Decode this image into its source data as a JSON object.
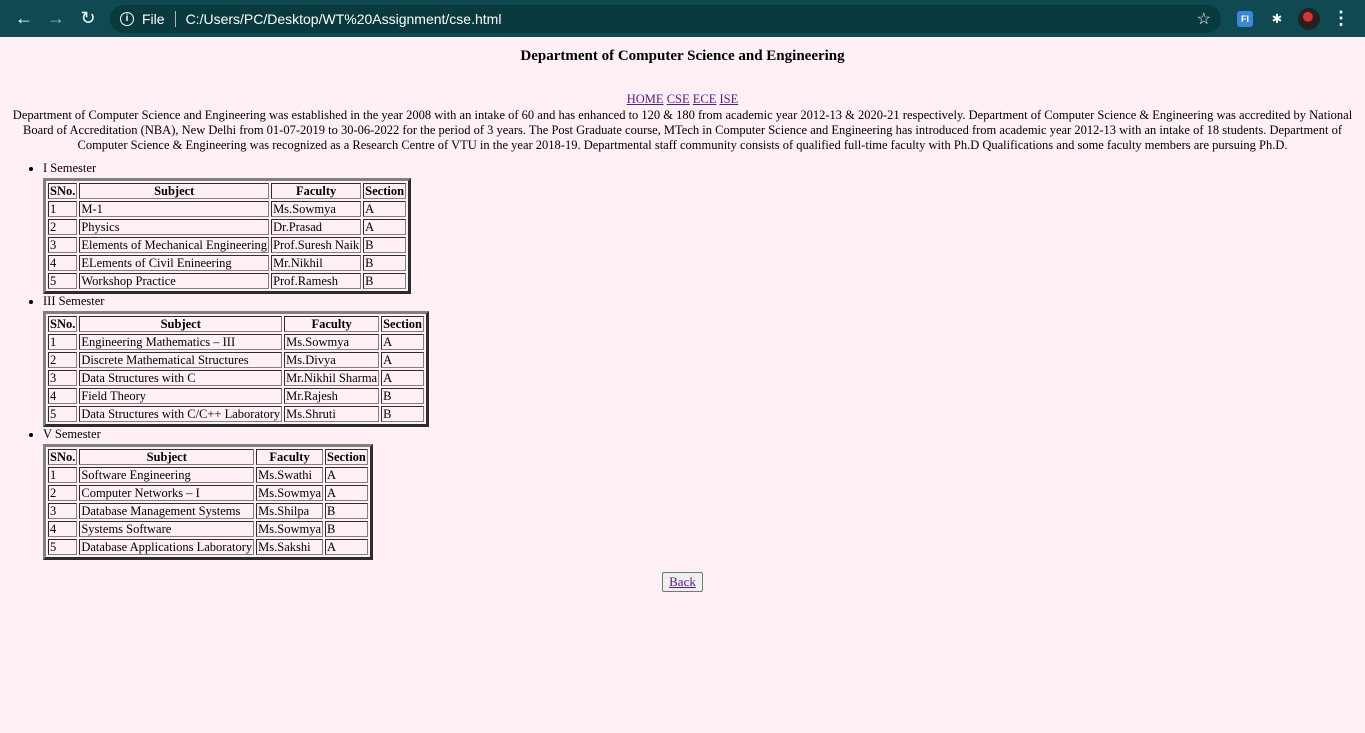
{
  "browser": {
    "scheme_label": "File",
    "url": "C:/Users/PC/Desktop/WT%20Assignment/cse.html",
    "ext_badge": "FI"
  },
  "page": {
    "title": "Department of Computer Science and Engineering",
    "nav_links": [
      "HOME",
      "CSE",
      "ECE",
      "ISE"
    ],
    "intro": "Department of Computer Science and Engineering was established in the year 2008 with an intake of 60 and has enhanced to 120 & 180 from academic year 2012-13 & 2020-21 respectively. Department of Computer Science & Engineering was accredited by National Board of Accreditation (NBA), New Delhi from 01-07-2019 to 30-06-2022 for the period of 3 years. The Post Graduate course, MTech in Computer Science and Engineering has introduced from academic year 2012-13 with an intake of 18 students. Department of Computer Science & Engineering was recognized as a Research Centre of VTU in the year 2018-19. Departmental staff community consists of qualified full-time faculty with Ph.D Qualifications and some faculty members are pursuing Ph.D.",
    "table_headers": [
      "SNo.",
      "Subject",
      "Faculty",
      "Section"
    ],
    "back_label": "Back"
  },
  "semesters": [
    {
      "label": "I Semester",
      "rows": [
        [
          "1",
          "M-1",
          "Ms.Sowmya",
          "A"
        ],
        [
          "2",
          "Physics",
          "Dr.Prasad",
          "A"
        ],
        [
          "3",
          "Elements of Mechanical Engineering",
          "Prof.Suresh Naik",
          "B"
        ],
        [
          "4",
          "ELements of Civil Enineering",
          "Mr.Nikhil",
          "B"
        ],
        [
          "5",
          "Workshop Practice",
          "Prof.Ramesh",
          "B"
        ]
      ]
    },
    {
      "label": "III Semester",
      "rows": [
        [
          "1",
          "Engineering Mathematics – III",
          "Ms.Sowmya",
          "A"
        ],
        [
          "2",
          "Discrete Mathematical Structures",
          "Ms.Divya",
          "A"
        ],
        [
          "3",
          "Data Structures with C",
          "Mr.Nikhil Sharma",
          "A"
        ],
        [
          "4",
          "Field Theory",
          "Mr.Rajesh",
          "B"
        ],
        [
          "5",
          "Data Structures with C/C++ Laboratory",
          "Ms.Shruti",
          "B"
        ]
      ]
    },
    {
      "label": "V Semester",
      "rows": [
        [
          "1",
          "Software Engineering",
          "Ms.Swathi",
          "A"
        ],
        [
          "2",
          "Computer Networks – I",
          "Ms.Sowmya",
          "A"
        ],
        [
          "3",
          "Database Management Systems",
          "Ms.Shilpa",
          "B"
        ],
        [
          "4",
          "Systems Software",
          "Ms.Sowmya",
          "B"
        ],
        [
          "5",
          "Database Applications Laboratory",
          "Ms.Sakshi",
          "A"
        ]
      ]
    }
  ]
}
